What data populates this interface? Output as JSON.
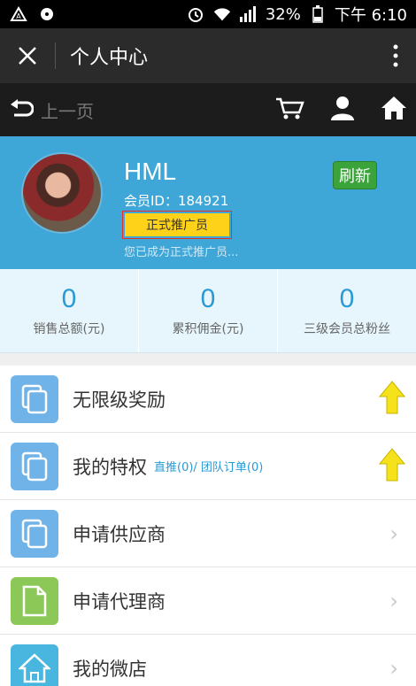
{
  "status": {
    "battery": "32%",
    "time": "下午 6:10"
  },
  "titlebar": {
    "title": "个人中心"
  },
  "navbar": {
    "back_label": "上一页"
  },
  "profile": {
    "name": "HML",
    "member_id": "会员ID：184921",
    "badge": "正式推广员",
    "hint": "您已成为正式推广员...",
    "refresh": "刷新"
  },
  "stats": [
    {
      "value": "0",
      "label": "销售总额(元)"
    },
    {
      "value": "0",
      "label": "累积佣金(元)"
    },
    {
      "value": "0",
      "label": "三级会员总粉丝"
    }
  ],
  "menu": [
    {
      "label": "无限级奖励",
      "icon": "copy-icon",
      "color": "#6fb3e8"
    },
    {
      "label": "我的特权",
      "sub": "直推(0)/ 团队订单(0)",
      "icon": "copy-icon",
      "color": "#6fb3e8"
    },
    {
      "label": "申请供应商",
      "icon": "copy-icon",
      "color": "#6fb3e8"
    },
    {
      "label": "申请代理商",
      "icon": "file-icon",
      "color": "#8cc857"
    },
    {
      "label": "我的微店",
      "icon": "home-icon",
      "color": "#49b6e0"
    }
  ],
  "colors": {
    "accent": "#3fa7d7",
    "badge": "#ffd21a",
    "refresh": "#3aa33a"
  }
}
